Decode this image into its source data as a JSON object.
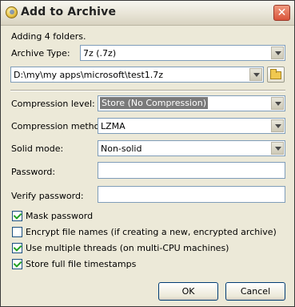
{
  "window": {
    "title": "Add to Archive",
    "close_symbol": "✕"
  },
  "summary": "Adding 4 folders.",
  "archive_type": {
    "label": "Archive Type:",
    "value": "7z (.7z)"
  },
  "path": {
    "value": "D:\\my\\my apps\\microsoft\\test1.7z"
  },
  "compression_level": {
    "label": "Compression level:",
    "value": "Store (No Compression)"
  },
  "compression_method": {
    "label": "Compression method:",
    "value": "LZMA"
  },
  "solid_mode": {
    "label": "Solid mode:",
    "value": "Non-solid"
  },
  "password": {
    "label": "Password:",
    "value": ""
  },
  "verify_password": {
    "label": "Verify password:",
    "value": ""
  },
  "options": [
    {
      "label": "Mask password",
      "checked": true
    },
    {
      "label": "Encrypt file names (if creating a new, encrypted archive)",
      "checked": false
    },
    {
      "label": "Use multiple threads (on multi-CPU machines)",
      "checked": true
    },
    {
      "label": "Store full file timestamps",
      "checked": true
    }
  ],
  "buttons": {
    "ok": "OK",
    "cancel": "Cancel"
  }
}
